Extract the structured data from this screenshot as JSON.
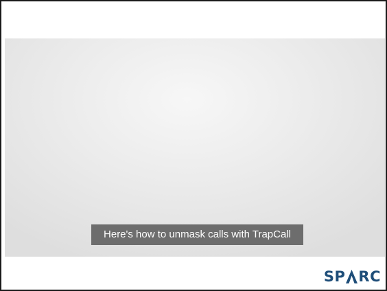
{
  "video": {
    "caption": "Here's how to unmask calls with TrapCall"
  },
  "branding": {
    "logo_text": "SPARC",
    "brand_color": "#1f4e79"
  }
}
